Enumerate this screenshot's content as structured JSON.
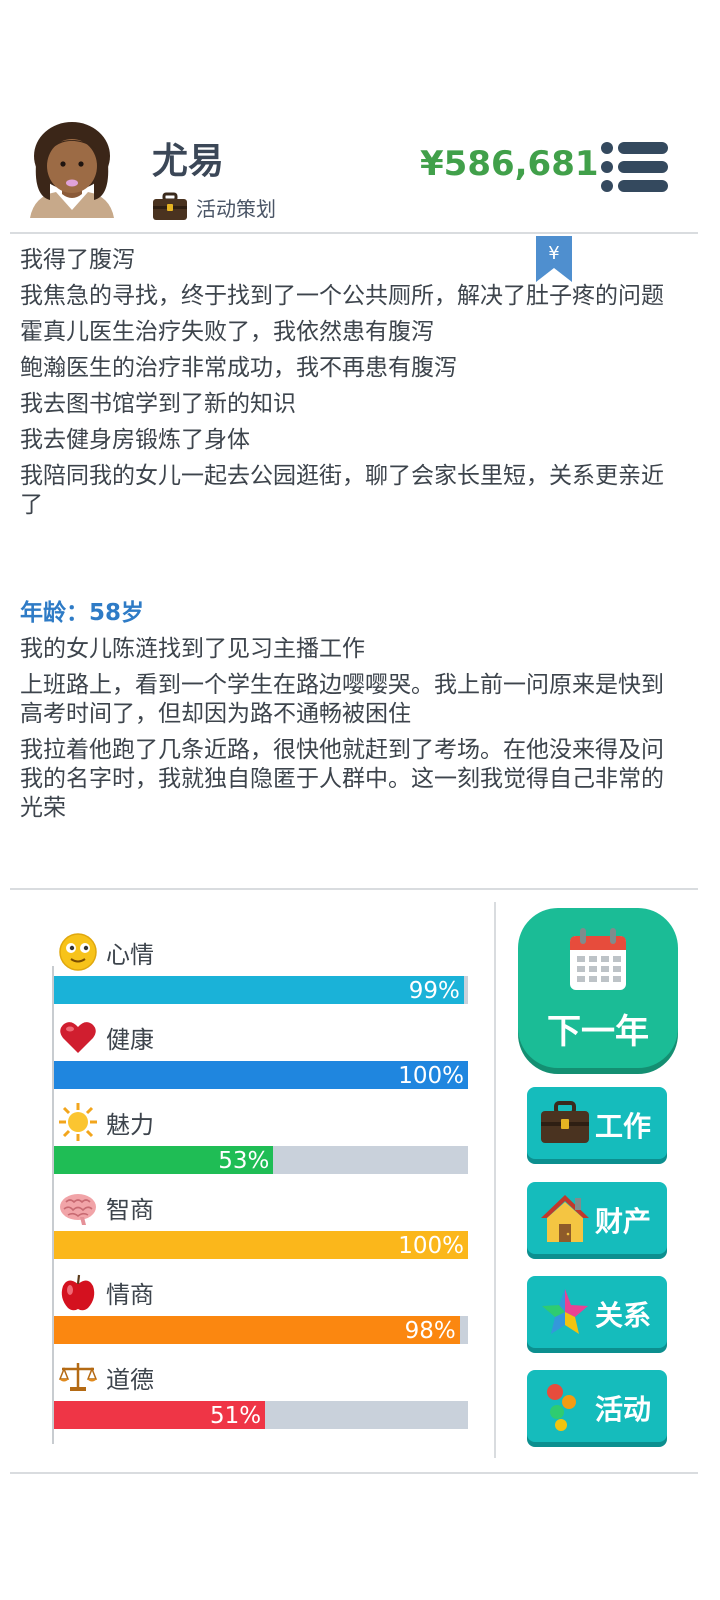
{
  "player": {
    "name": "尤易",
    "job": "活动策划",
    "money": "¥586,681"
  },
  "bookmark_symbol": "¥",
  "log": {
    "lines_before": [
      "我得了腹泻",
      "我焦急的寻找，终于找到了一个公共厕所，解决了肚子疼的问题",
      "霍真儿医生治疗失败了，我依然患有腹泻",
      "鲍瀚医生的治疗非常成功，我不再患有腹泻",
      "我去图书馆学到了新的知识",
      "我去健身房锻炼了身体",
      "我陪同我的女儿一起去公园逛街，聊了会家长里短，关系更亲近了"
    ],
    "age_heading": "年龄：58岁",
    "lines_after": [
      "我的女儿陈涟找到了见习主播工作",
      "上班路上，看到一个学生在路边嘤嘤哭。我上前一问原来是快到高考时间了，但却因为路不通畅被困住",
      "我拉着他跑了几条近路，很快他就赶到了考场。在他没来得及问我的名字时，我就独自隐匿于人群中。这一刻我觉得自己非常的光荣"
    ]
  },
  "stats": [
    {
      "label": "心情",
      "value": 99,
      "pct": "99%",
      "color": "#1ab2d8",
      "icon": "smiley-icon"
    },
    {
      "label": "健康",
      "value": 100,
      "pct": "100%",
      "color": "#1f86df",
      "icon": "heart-icon"
    },
    {
      "label": "魅力",
      "value": 53,
      "pct": "53%",
      "color": "#1fbd55",
      "icon": "sun-icon"
    },
    {
      "label": "智商",
      "value": 100,
      "pct": "100%",
      "color": "#fbb71b",
      "icon": "brain-icon"
    },
    {
      "label": "情商",
      "value": 98,
      "pct": "98%",
      "color": "#fb8710",
      "icon": "apple-icon"
    },
    {
      "label": "道德",
      "value": 51,
      "pct": "51%",
      "color": "#ef3546",
      "icon": "scales-icon"
    }
  ],
  "buttons": {
    "next_year": "下一年",
    "work": "工作",
    "assets": "财产",
    "relations": "关系",
    "activities": "活动"
  }
}
